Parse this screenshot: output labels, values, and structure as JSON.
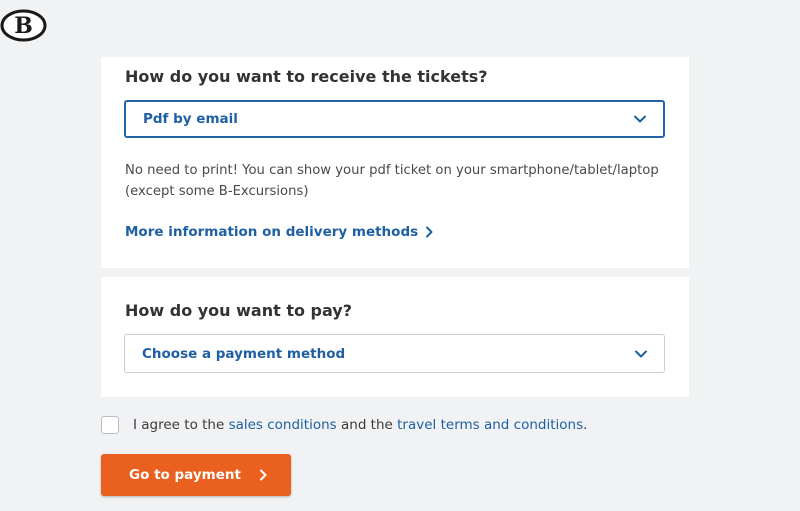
{
  "brand": {
    "logo_letter": "B",
    "logo_icon": "sncb-logo"
  },
  "delivery": {
    "title": "How do you want to receive the tickets?",
    "selected_option": "Pdf by email",
    "description": "No need to print! You can show your pdf ticket on your smartphone/tablet/laptop (except some B-Excursions)",
    "more_info_link": "More information on delivery methods"
  },
  "payment": {
    "title": "How do you want to pay?",
    "selected_option": "Choose a payment method"
  },
  "agreement": {
    "text_before": "I agree to the ",
    "sales_link": "sales conditions",
    "text_middle": " and the ",
    "travel_link": "travel terms and conditions",
    "text_after": ".",
    "checked": false
  },
  "cta": {
    "label": "Go to payment"
  },
  "colors": {
    "accent_blue": "#1f5fa3",
    "cta_orange": "#e9601f",
    "background": "#f1f2f3"
  }
}
